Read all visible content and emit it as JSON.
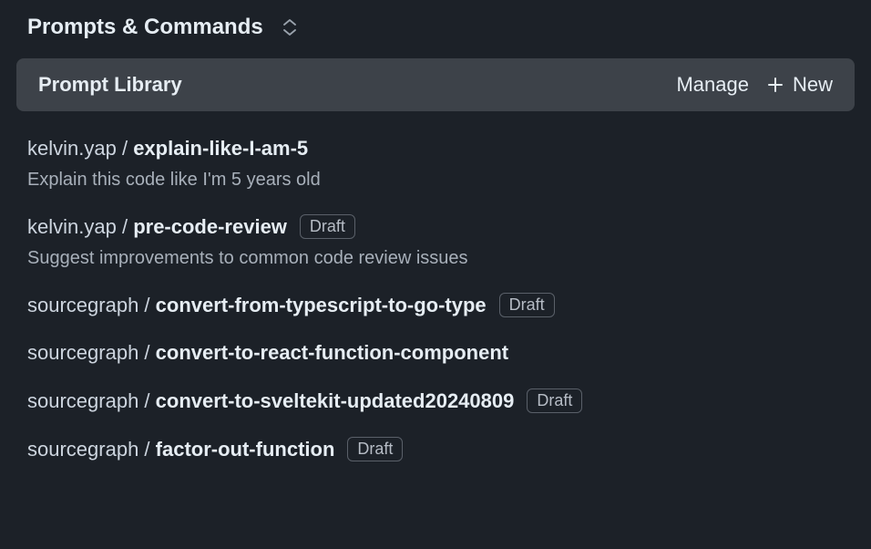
{
  "header": {
    "title": "Prompts & Commands"
  },
  "library_bar": {
    "title": "Prompt Library",
    "manage_label": "Manage",
    "new_label": "New"
  },
  "draft_label": "Draft",
  "items": [
    {
      "owner": "kelvin.yap",
      "name": "explain-like-I-am-5",
      "description": "Explain this code like I'm 5 years old",
      "draft": false
    },
    {
      "owner": "kelvin.yap",
      "name": "pre-code-review",
      "description": "Suggest improvements to common code review issues",
      "draft": true
    },
    {
      "owner": "sourcegraph",
      "name": "convert-from-typescript-to-go-type",
      "description": "",
      "draft": true
    },
    {
      "owner": "sourcegraph",
      "name": "convert-to-react-function-component",
      "description": "",
      "draft": false
    },
    {
      "owner": "sourcegraph",
      "name": "convert-to-sveltekit-updated20240809",
      "description": "",
      "draft": true
    },
    {
      "owner": "sourcegraph",
      "name": "factor-out-function",
      "description": "",
      "draft": true
    }
  ]
}
